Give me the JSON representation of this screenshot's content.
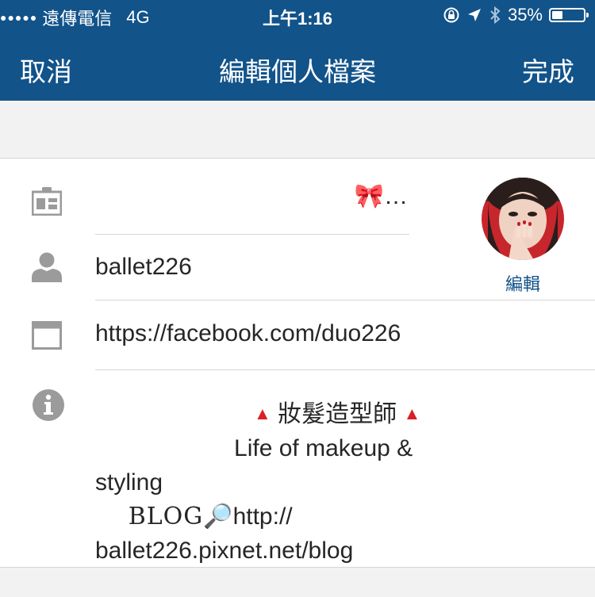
{
  "status_bar": {
    "signal_dots": "●●●●●",
    "carrier": "遠傳電信",
    "network": "4G",
    "time": "上午1:16",
    "battery_percent_label": "35%",
    "battery_level": 0.35
  },
  "nav": {
    "cancel_label": "取消",
    "title": "編輯個人檔案",
    "done_label": "完成"
  },
  "profile": {
    "name_value": "🎀…",
    "username_value": "ballet226",
    "website_value": "https://facebook.com/duo226",
    "avatar_edit_label": "編輯",
    "bio": {
      "line1_indent": "                        ",
      "line1_triangle_left": "▲",
      "line1_text": " 妝髮造型師 ",
      "line1_triangle_right": "▲",
      "line2": "                     Life of makeup &",
      "line3": "styling",
      "line4_indent": "     ",
      "line4_blog": "BLOG",
      "line4_emoji": "🔎",
      "line4_text": "http://",
      "line5": "ballet226.pixnet.net/blog"
    }
  },
  "colors": {
    "header_bg": "#12538a",
    "icon_gray": "#9b9b9b",
    "accent_red": "#d92027",
    "divider": "#d6d6d6"
  },
  "icons": {
    "name_field": "id-card-icon",
    "username_field": "person-icon",
    "website_field": "browser-window-icon",
    "bio_field": "info-icon"
  }
}
